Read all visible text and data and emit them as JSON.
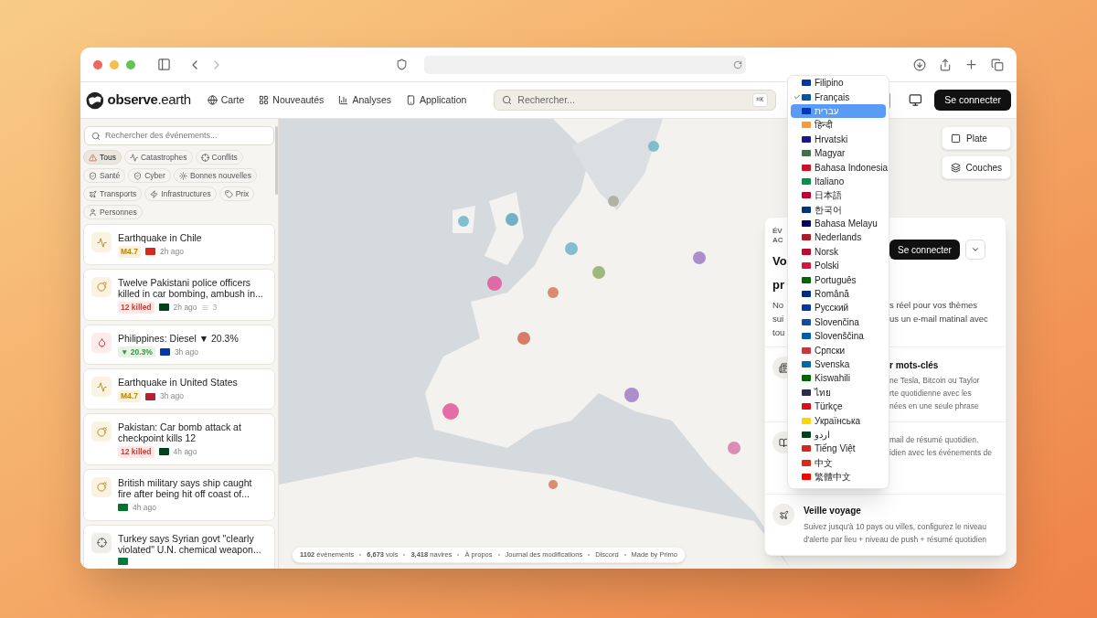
{
  "header": {
    "logo": "observe",
    "logo_suffix": ".earth",
    "nav": [
      {
        "label": "Carte",
        "kind": "globe"
      },
      {
        "label": "Nouveautés",
        "kind": "grid"
      },
      {
        "label": "Analyses",
        "kind": "bars"
      },
      {
        "label": "Application",
        "kind": "phone"
      }
    ],
    "search": {
      "placeholder": "Rechercher...",
      "shortcut": "⌘K"
    },
    "login": "Se connecter"
  },
  "sidebar": {
    "search": {
      "placeholder": "Rechercher des événements..."
    },
    "filters": [
      {
        "label": "Tous",
        "kind": "alert",
        "selected": true
      },
      {
        "label": "Catastrophes",
        "kind": "pulse",
        "selected": false
      },
      {
        "label": "Conflits",
        "kind": "target",
        "selected": false
      },
      {
        "label": "Santé",
        "kind": "shield",
        "selected": false
      },
      {
        "label": "Cyber",
        "kind": "shield",
        "selected": false
      },
      {
        "label": "Bonnes nouvelles",
        "kind": "sun",
        "selected": false
      },
      {
        "label": "Transports",
        "kind": "plane",
        "selected": false
      },
      {
        "label": "Infrastructures",
        "kind": "bolt",
        "selected": false
      },
      {
        "label": "Prix",
        "kind": "tag",
        "selected": false
      },
      {
        "label": "Personnes",
        "kind": "user",
        "selected": false
      }
    ],
    "events": [
      {
        "kind": "pulse",
        "title": "Earthquake in Chile",
        "badge": {
          "kind": "magnitude",
          "text": "M4.7"
        },
        "color": "#d52b1e",
        "time": "2h ago"
      },
      {
        "kind": "bomb",
        "title": "Twelve Pakistani police officers killed in car bombing, ambush in...",
        "badge": {
          "kind": "killed",
          "text": "12 killed"
        },
        "color": "#01411c",
        "time": "2h ago",
        "count": "3"
      },
      {
        "kind": "drop",
        "title": "Philippines: Diesel ▼ 20.3%",
        "badge": {
          "kind": "price",
          "text": "▼ 20.3%"
        },
        "color": "#0038a8",
        "time": "3h ago"
      },
      {
        "kind": "pulse",
        "title": "Earthquake in United States",
        "badge": {
          "kind": "magnitude",
          "text": "M4.7"
        },
        "color": "#b22234",
        "time": "3h ago"
      },
      {
        "kind": "bomb",
        "title": "Pakistan: Car bomb attack at checkpoint kills 12",
        "badge": {
          "kind": "killed",
          "text": "12 killed"
        },
        "color": "#01411c",
        "time": "4h ago"
      },
      {
        "kind": "bomb",
        "title": "British military says ship caught fire after being hit off coast of...",
        "color": "#00732f",
        "time": "4h ago"
      },
      {
        "kind": "target",
        "title": "Turkey says Syrian govt \"clearly violated\" U.N. chemical weapon...",
        "color": "#007a3d"
      }
    ]
  },
  "map": {
    "controls": [
      {
        "label": "Plate",
        "kind": "square"
      },
      {
        "label": "Couches",
        "kind": "layers"
      }
    ],
    "footer": {
      "stats": [
        "**1102** événements",
        "**6,673** vols",
        "**3,418** navires"
      ],
      "links": [
        "À propos",
        "Journal des modifications",
        "Discord",
        "Made by Primo"
      ]
    }
  },
  "panel": {
    "eyebrow": [
      "ÉV",
      "AC"
    ],
    "title": [
      "Vo",
      "pr"
    ],
    "login": "Se connecter",
    "intro": [
      {
        "left": "No",
        "right": "s réel pour vos thèmes"
      },
      {
        "left": "sui",
        "right": "us un e-mail matinal avec"
      },
      {
        "left": "tou"
      }
    ],
    "sections": [
      {
        "kind": "covered",
        "title": "r mots-clés",
        "lines": [
          "ne Tesla, Bitcoin ou Taylor",
          "rte quotidienne avec les",
          "nées en une seule phrase"
        ]
      },
      {
        "kind": "covered",
        "lines": [
          "mail de résumé quotidien.",
          "idien avec les événements de"
        ]
      },
      {
        "kind": "full",
        "title": "Veille voyage",
        "desc": "Suivez jusqu'à 10 pays ou villes, configurez le niveau d'alerte par lieu + niveau de push + résumé quotidien"
      }
    ]
  },
  "languages": [
    {
      "label": "Filipino",
      "color": "#0038a8",
      "checked": false,
      "selected": false
    },
    {
      "label": "Français",
      "color": "#0055a4",
      "checked": true,
      "selected": false
    },
    {
      "label": "עברית",
      "color": "#0038b8",
      "checked": false,
      "selected": true
    },
    {
      "label": "हिन्दी",
      "color": "#ff9933",
      "checked": false,
      "selected": false
    },
    {
      "label": "Hrvatski",
      "color": "#171796",
      "checked": false,
      "selected": false
    },
    {
      "label": "Magyar",
      "color": "#436f4d",
      "checked": false,
      "selected": false
    },
    {
      "label": "Bahasa Indonesia",
      "color": "#ce1126",
      "checked": false,
      "selected": false
    },
    {
      "label": "Italiano",
      "color": "#009246",
      "checked": false,
      "selected": false
    },
    {
      "label": "日本語",
      "color": "#bc002d",
      "checked": false,
      "selected": false
    },
    {
      "label": "한국어",
      "color": "#003478",
      "checked": false,
      "selected": false
    },
    {
      "label": "Bahasa Melayu",
      "color": "#010066",
      "checked": false,
      "selected": false
    },
    {
      "label": "Nederlands",
      "color": "#ae1c28",
      "checked": false,
      "selected": false
    },
    {
      "label": "Norsk",
      "color": "#ba0c2f",
      "checked": false,
      "selected": false
    },
    {
      "label": "Polski",
      "color": "#dc143c",
      "checked": false,
      "selected": false
    },
    {
      "label": "Português",
      "color": "#006600",
      "checked": false,
      "selected": false
    },
    {
      "label": "Română",
      "color": "#002b7f",
      "checked": false,
      "selected": false
    },
    {
      "label": "Русский",
      "color": "#0039a6",
      "checked": false,
      "selected": false
    },
    {
      "label": "Slovenčina",
      "color": "#0b4ea2",
      "checked": false,
      "selected": false
    },
    {
      "label": "Slovenščina",
      "color": "#005da4",
      "checked": false,
      "selected": false
    },
    {
      "label": "Српски",
      "color": "#c6363c",
      "checked": false,
      "selected": false
    },
    {
      "label": "Svenska",
      "color": "#006aa7",
      "checked": false,
      "selected": false
    },
    {
      "label": "Kiswahili",
      "color": "#006600",
      "checked": false,
      "selected": false
    },
    {
      "label": "ไทย",
      "color": "#2d2a4a",
      "checked": false,
      "selected": false
    },
    {
      "label": "Türkçe",
      "color": "#e30a17",
      "checked": false,
      "selected": false
    },
    {
      "label": "Українська",
      "color": "#ffd500",
      "checked": false,
      "selected": false
    },
    {
      "label": "اردو",
      "color": "#01411c",
      "checked": false,
      "selected": false
    },
    {
      "label": "Tiếng Việt",
      "color": "#da251d",
      "checked": false,
      "selected": false
    },
    {
      "label": "中文",
      "color": "#de2910",
      "checked": false,
      "selected": false
    },
    {
      "label": "繁體中文",
      "color": "#fe0000",
      "checked": false,
      "selected": false
    }
  ]
}
